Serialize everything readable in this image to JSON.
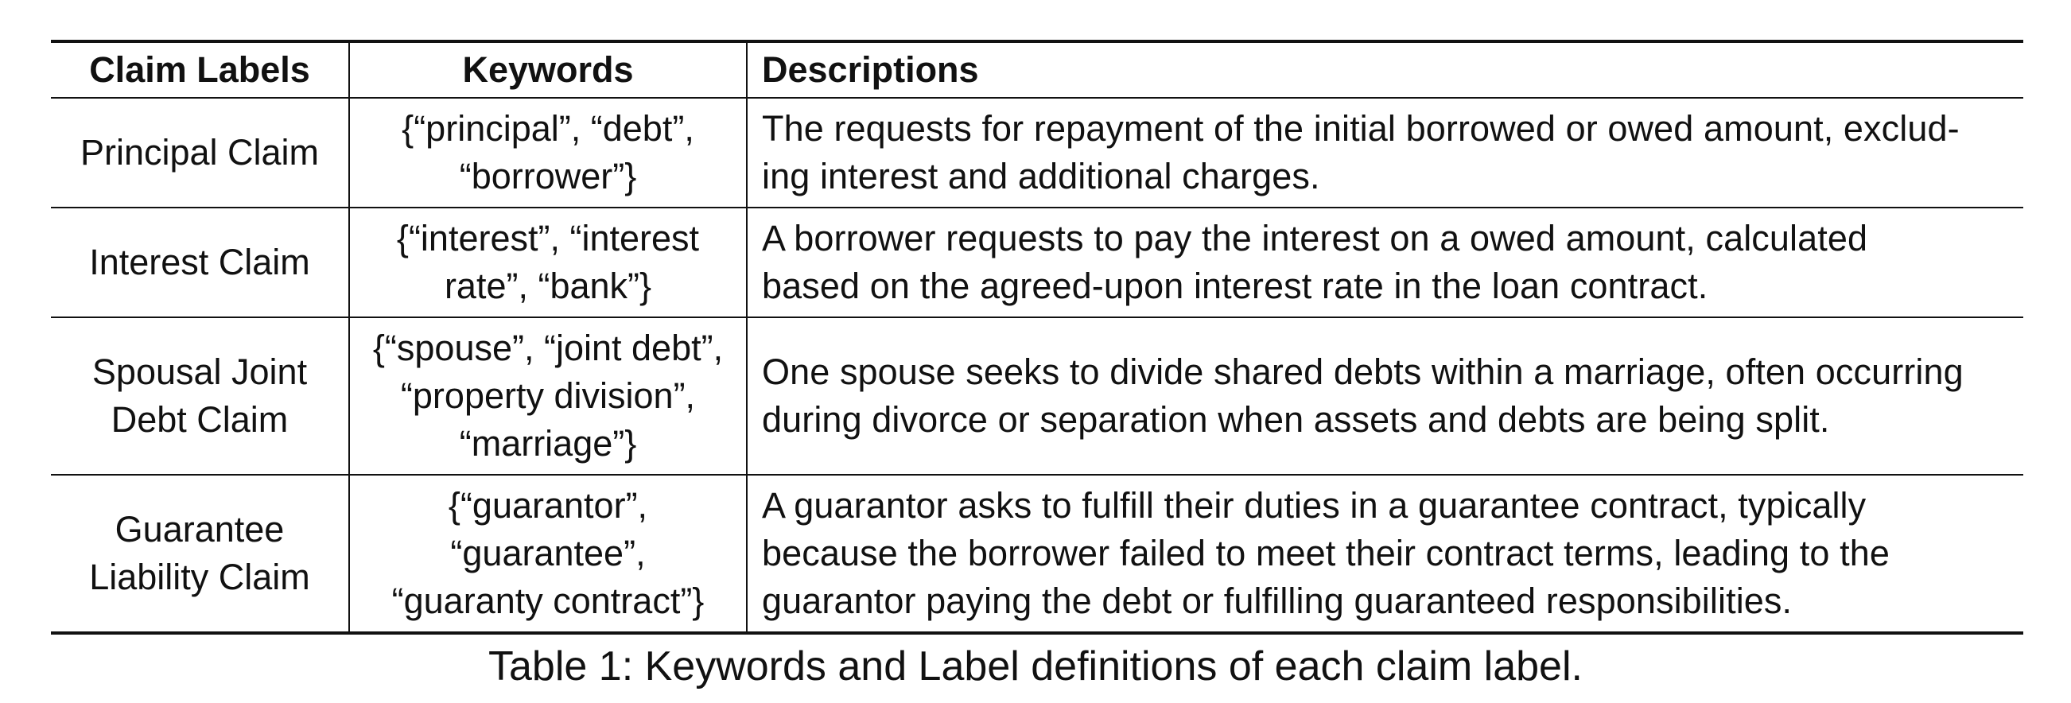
{
  "table": {
    "headers": [
      "Claim Labels",
      "Keywords",
      "Descriptions"
    ],
    "rows": [
      {
        "label_lines": [
          "Principal Claim"
        ],
        "keyword_lines": [
          "{“principal”, “debt”,",
          "“borrower”}"
        ],
        "description_lines": [
          "The requests for repayment of the initial borrowed or owed amount, exclud-",
          "ing interest and additional charges."
        ]
      },
      {
        "label_lines": [
          "Interest Claim"
        ],
        "keyword_lines": [
          "{“interest”, “interest",
          "rate”, “bank”}"
        ],
        "description_lines": [
          "A borrower requests to pay the interest on a owed amount, calculated",
          "based on the agreed-upon interest rate in the loan contract."
        ]
      },
      {
        "label_lines": [
          "Spousal Joint",
          "Debt Claim"
        ],
        "keyword_lines": [
          "{“spouse”, “joint debt”,",
          "“property division”,",
          "“marriage”}"
        ],
        "description_lines": [
          "One spouse seeks to divide shared debts within a marriage, often occurring",
          "during divorce or separation when assets and debts are being split."
        ]
      },
      {
        "label_lines": [
          "Guarantee",
          "Liability Claim"
        ],
        "keyword_lines": [
          "{“guarantor”,",
          "“guarantee”,",
          "“guaranty contract”}"
        ],
        "description_lines": [
          "A guarantor asks to fulfill their duties in a guarantee contract, typically",
          "because the borrower failed to meet their contract terms, leading to the",
          "guarantor paying the debt or fulfilling guaranteed responsibilities."
        ]
      }
    ]
  },
  "caption": "Table 1: Keywords and Label definitions of each claim label."
}
